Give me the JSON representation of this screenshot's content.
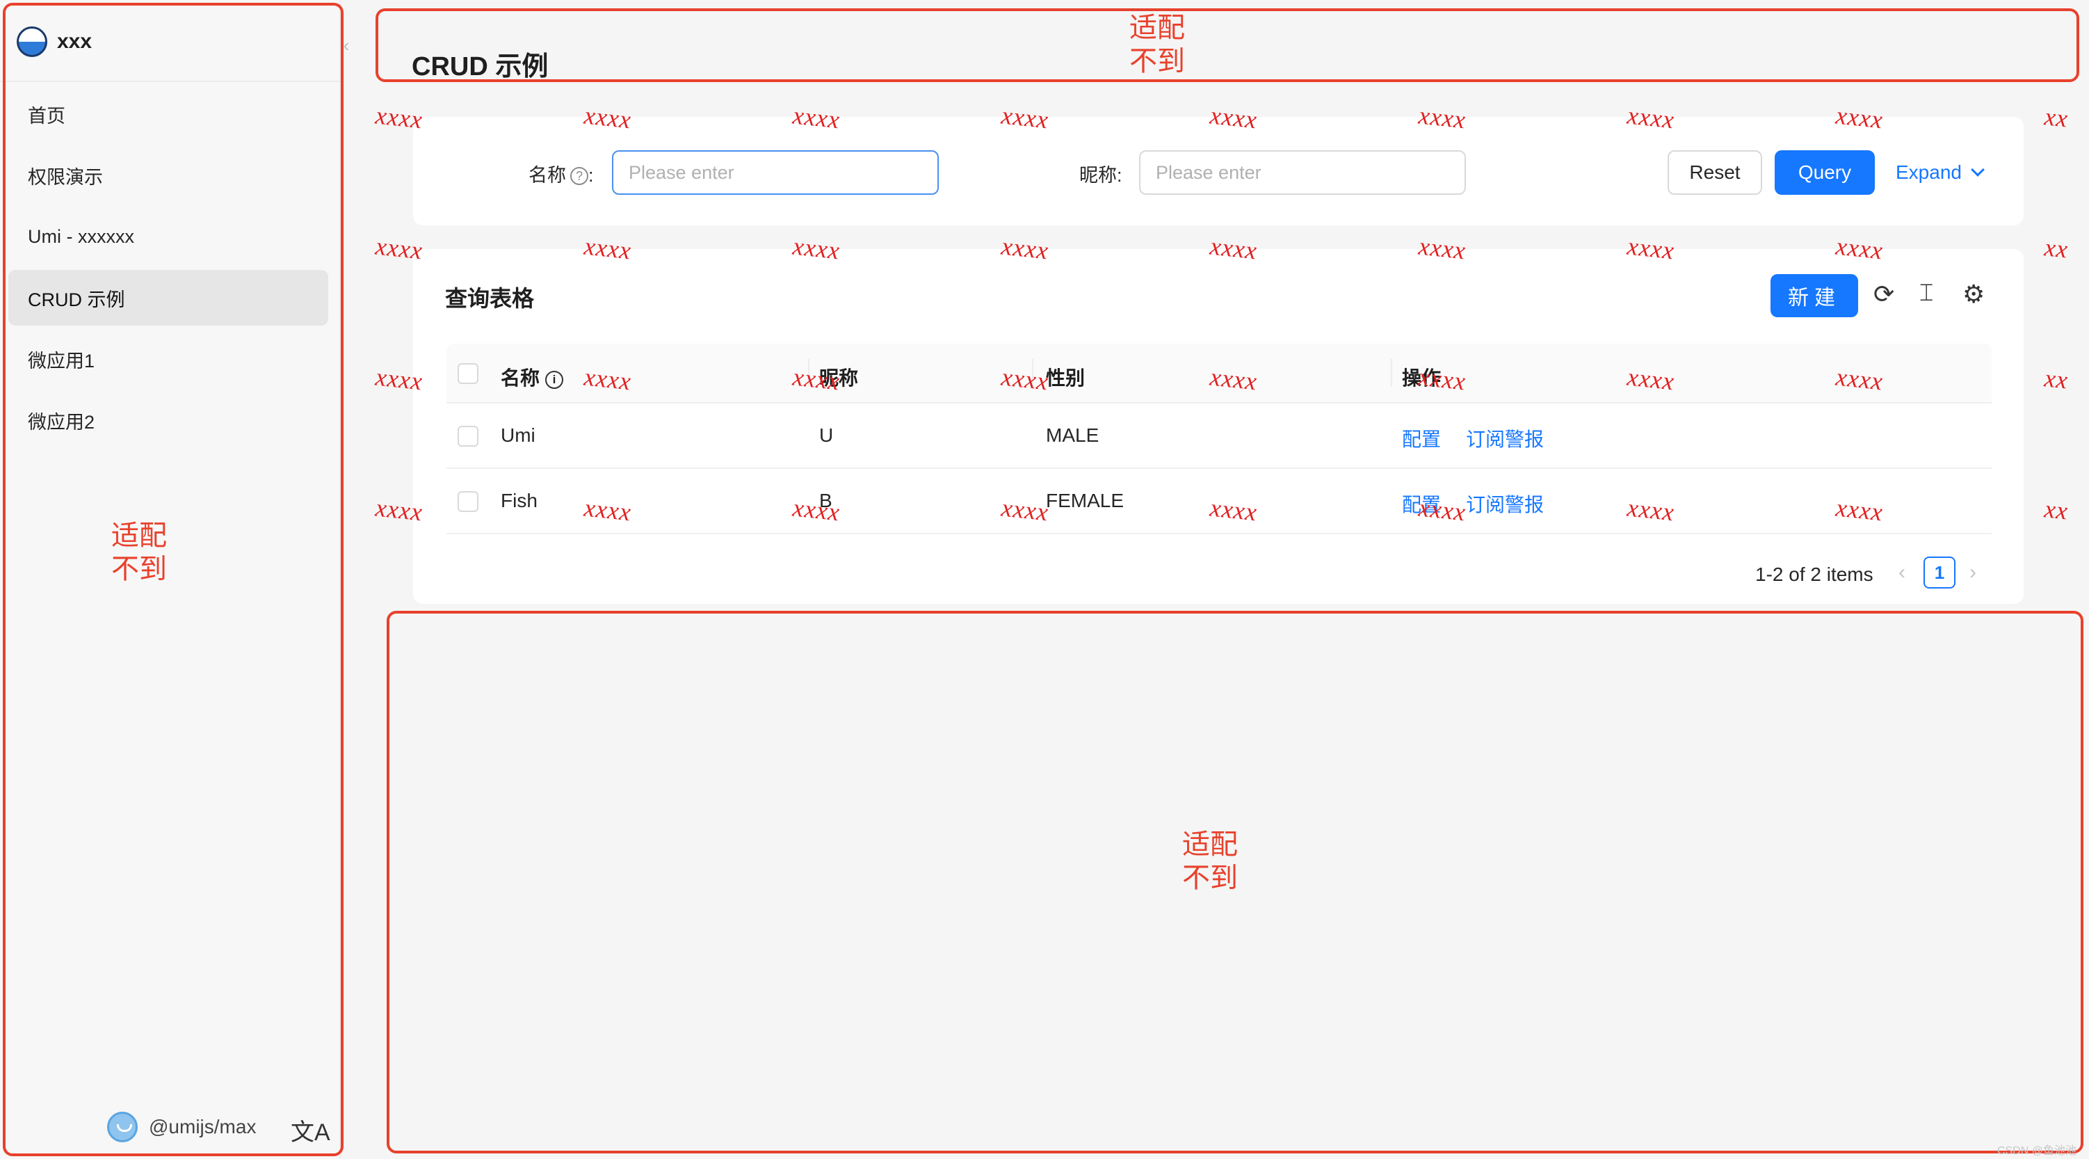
{
  "app": {
    "logo_text": "xxx"
  },
  "sidebar": {
    "items": [
      {
        "label": "首页"
      },
      {
        "label": "权限演示"
      },
      {
        "label": "Umi - xxxxxx"
      },
      {
        "label": "CRUD 示例"
      },
      {
        "label": "微应用1"
      },
      {
        "label": "微应用2"
      }
    ],
    "user": "@umijs/max",
    "collapse_glyph": "‹",
    "lang_glyph": "文A"
  },
  "page": {
    "title": "CRUD 示例"
  },
  "search": {
    "name_label": "名称",
    "nickname_label": "昵称",
    "colon": ":",
    "placeholder": "Please enter",
    "reset": "Reset",
    "query": "Query",
    "expand": "Expand"
  },
  "table": {
    "title": "查询表格",
    "new_button": "新建",
    "columns": [
      "名称",
      "昵称",
      "性别",
      "操作"
    ],
    "rows": [
      {
        "name": "Umi",
        "nickname": "U",
        "gender": "MALE",
        "action1": "配置",
        "action2": "订阅警报"
      },
      {
        "name": "Fish",
        "nickname": "B",
        "gender": "FEMALE",
        "action1": "配置",
        "action2": "订阅警报"
      }
    ],
    "icons": {
      "reload": "reload-icon",
      "density": "column-height-icon",
      "settings": "setting-icon"
    }
  },
  "pagination": {
    "total_text": "1-2 of 2 items",
    "current": "1",
    "prev": "‹",
    "next": "›"
  },
  "annotations": {
    "note_line1": "适配",
    "note_line2": "不到",
    "marker": "xxxx",
    "marker_cut": "xx",
    "color": "#e8412c"
  },
  "watermark": "CSDN @鱼池池"
}
